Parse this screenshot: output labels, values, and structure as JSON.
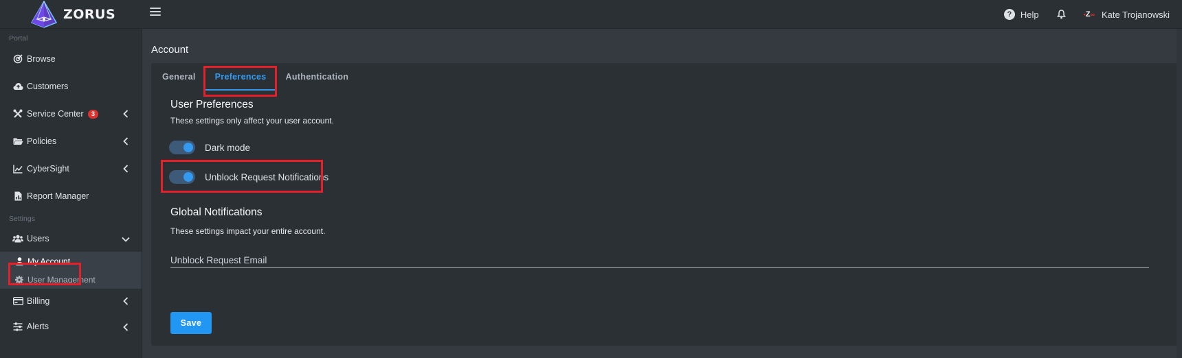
{
  "brand": {
    "name": "ZORUS",
    "accent": "#339af0",
    "danger": "#e5202a"
  },
  "topbar": {
    "help_label": "Help",
    "user_initials": "Z",
    "user_name": "Kate Trojanowski"
  },
  "sidebar": {
    "portal_label": "Portal",
    "settings_label": "Settings",
    "items": [
      {
        "label": "Browse",
        "icon": "browse-icon"
      },
      {
        "label": "Customers",
        "icon": "cloud-icon"
      },
      {
        "label": "Service Center",
        "icon": "tools-icon",
        "badge": "3"
      },
      {
        "label": "Policies",
        "icon": "folder-icon"
      },
      {
        "label": "CyberSight",
        "icon": "chart-icon"
      },
      {
        "label": "Report Manager",
        "icon": "report-icon"
      },
      {
        "label": "Users",
        "icon": "users-icon"
      },
      {
        "label": "Billing",
        "icon": "billing-icon"
      },
      {
        "label": "Alerts",
        "icon": "sliders-icon"
      }
    ],
    "users_sub": [
      {
        "label": "My Account",
        "active": true
      },
      {
        "label": "User Management",
        "active": false
      }
    ]
  },
  "main": {
    "title": "Account",
    "tabs": [
      {
        "label": "General",
        "active": false
      },
      {
        "label": "Preferences",
        "active": true
      },
      {
        "label": "Authentication",
        "active": false
      }
    ],
    "user_prefs": {
      "heading": "User Preferences",
      "description": "These settings only affect your user account.",
      "dark_mode_label": "Dark mode",
      "dark_mode_on": true,
      "unblock_notif_label": "Unblock Request Notifications",
      "unblock_notif_on": true
    },
    "global": {
      "heading": "Global Notifications",
      "description": "These settings impact your entire account.",
      "email_placeholder": "Unblock Request Email",
      "email_value": ""
    },
    "save_label": "Save"
  }
}
